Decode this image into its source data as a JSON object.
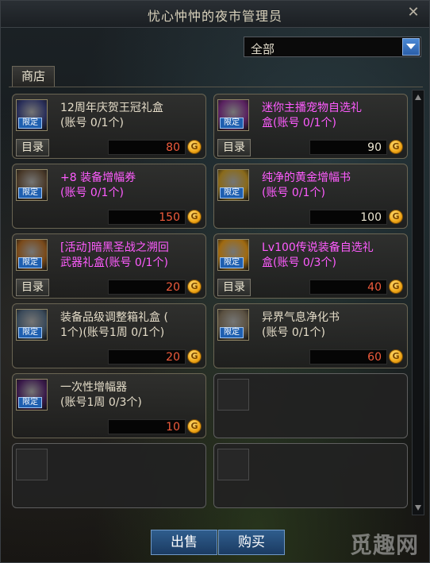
{
  "window": {
    "title": "忧心忡忡的夜市管理员",
    "close_glyph": "✕"
  },
  "filter": {
    "selected": "全部"
  },
  "tab": {
    "label": "商店"
  },
  "detail_label": "目录",
  "limit_label": "限定",
  "coin_glyph": "G",
  "colors": {
    "purple_name": "#ff5cff",
    "price_red": "#f05b3c",
    "accent_blue": "#1e5fb0"
  },
  "items": [
    {
      "name": "12周年庆贺王冠礼盒\n(账号 0/1个)",
      "name_color": "white",
      "price": "80",
      "price_color": "red",
      "detail": true,
      "icon": "crown-gift-box-icon",
      "icon_bg": "#2a2f5a"
    },
    {
      "name": "迷你主播宠物自选礼\n盒(账号 0/1个)",
      "name_color": "purple",
      "price": "90",
      "price_color": "white",
      "detail": true,
      "icon": "pet-gift-box-icon",
      "icon_bg": "#5a2260"
    },
    {
      "name": "+8 装备增幅券\n(账号 0/1个)",
      "name_color": "purple",
      "price": "150",
      "price_color": "red",
      "detail": false,
      "icon": "amplify-ticket-icon",
      "icon_bg": "#4a3a2a"
    },
    {
      "name": "纯净的黄金增幅书\n(账号 0/1个)",
      "name_color": "purple",
      "price": "100",
      "price_color": "white",
      "detail": false,
      "icon": "golden-book-icon",
      "icon_bg": "#8a6a1a"
    },
    {
      "name": "[活动]暗黑圣战之溯回\n武器礼盒(账号 0/1个)",
      "name_color": "purple",
      "price": "20",
      "price_color": "red",
      "detail": true,
      "icon": "weapon-gift-box-icon",
      "icon_bg": "#7a4a1a"
    },
    {
      "name": "Lv100传说装备自选礼\n盒(账号 0/3个)",
      "name_color": "purple",
      "price": "40",
      "price_color": "red",
      "detail": true,
      "icon": "legend-gear-box-icon",
      "icon_bg": "#a06a10"
    },
    {
      "name": "装备品级调整箱礼盒 (\n1个)(账号1周 0/1个)",
      "name_color": "white",
      "price": "20",
      "price_color": "red",
      "detail": false,
      "icon": "grade-box-icon",
      "icon_bg": "#3a4a5a"
    },
    {
      "name": "异界气息净化书\n(账号 0/1个)",
      "name_color": "white",
      "price": "60",
      "price_color": "red",
      "detail": false,
      "icon": "purify-book-icon",
      "icon_bg": "#5a5040"
    },
    {
      "name": "一次性增幅器\n(账号1周 0/3个)",
      "name_color": "white",
      "price": "10",
      "price_color": "red",
      "detail": false,
      "icon": "one-time-amplifier-icon",
      "icon_bg": "#3a1a4a"
    }
  ],
  "buttons": {
    "sell": "出售",
    "buy": "购买"
  },
  "watermark": "觅趣网"
}
